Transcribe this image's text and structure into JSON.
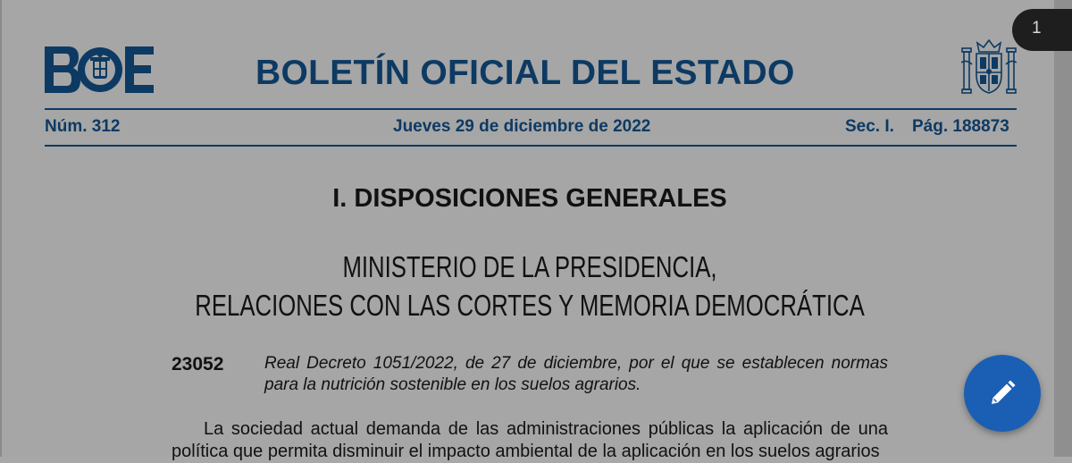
{
  "document": {
    "masthead": {
      "logo_text": "BOE",
      "title": "BOLETÍN OFICIAL DEL ESTADO",
      "crest_icon": "spanish-coat-of-arms-icon"
    },
    "meta": {
      "number": "Núm. 312",
      "date": "Jueves 29 de diciembre de 2022",
      "section": "Sec. I.",
      "page": "Pág. 188873"
    },
    "section_heading": "I. DISPOSICIONES GENERALES",
    "ministry": {
      "line1": "MINISTERIO DE LA PRESIDENCIA,",
      "line2": "RELACIONES CON LAS CORTES Y MEMORIA DEMOCRÁTICA"
    },
    "decree": {
      "number": "23052",
      "title": "Real Decreto 1051/2022, de 27 de diciembre, por el que se establecen normas para la nutrición sostenible en los suelos agrarios."
    },
    "body": "La sociedad actual demanda de las administraciones públicas la aplicación de una política que permita disminuir el impacto ambiental de la aplicación en los suelos agrarios"
  },
  "viewer": {
    "page_indicator": "1",
    "edit_button_icon": "pencil-icon",
    "accent_color": "#1b5fb4",
    "brand_color": "#0d3a63"
  }
}
